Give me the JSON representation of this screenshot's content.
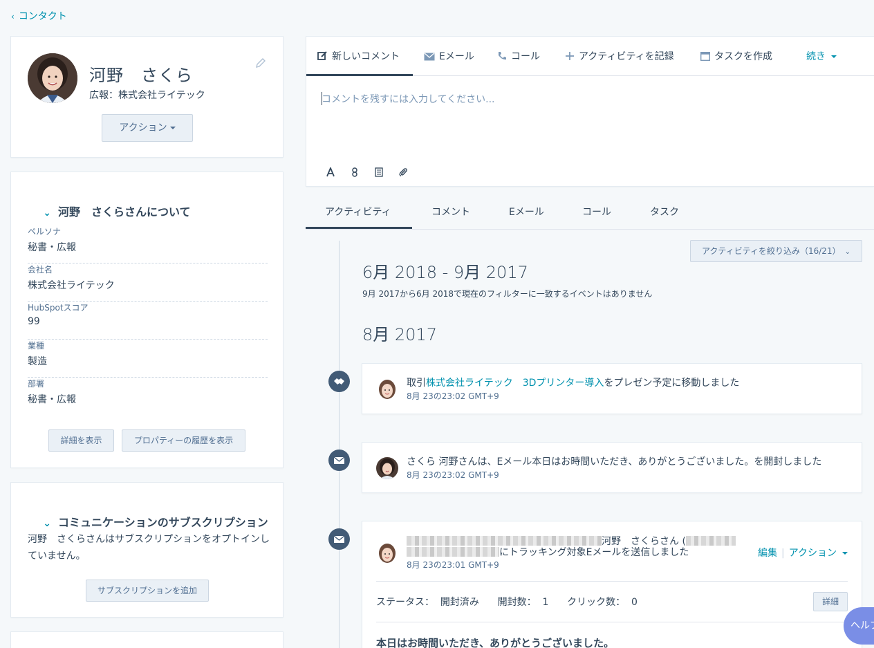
{
  "nav": {
    "back_label": "コンタクト"
  },
  "profile": {
    "name": "河野　さくら",
    "title": "広報：株式会社ライテック",
    "action_button": "アクション"
  },
  "about": {
    "heading": "河野　さくらさんについて",
    "properties": [
      {
        "label": "ペルソナ",
        "value": "秘書・広報"
      },
      {
        "label": "会社名",
        "value": "株式会社ライテック"
      },
      {
        "label": "HubSpotスコア",
        "value": "99"
      },
      {
        "label": "業種",
        "value": "製造"
      },
      {
        "label": "部署",
        "value": "秘書・広報"
      }
    ],
    "show_details_button": "詳細を表示",
    "property_history_button": "プロパティーの履歴を表示"
  },
  "subscriptions": {
    "heading": "コミュニケーションのサブスクリプション",
    "text": "河野　さくらさんはサブスクリプションをオプトインしていません。",
    "add_button": "サブスクリプションを追加"
  },
  "composer": {
    "tabs": [
      {
        "label": "新しいコメント",
        "icon": "edit-icon"
      },
      {
        "label": "Eメール",
        "icon": "email-icon"
      },
      {
        "label": "コール",
        "icon": "phone-icon"
      },
      {
        "label": "アクティビティを記録",
        "icon": "plus-icon"
      },
      {
        "label": "タスクを作成",
        "icon": "task-icon"
      }
    ],
    "more_label": "続き",
    "placeholder": "コメントを残すには入力してください..."
  },
  "activity_tabs": [
    "アクティビティ",
    "コメント",
    "Eメール",
    "コール",
    "タスク"
  ],
  "timeline": {
    "filter_label": "アクティビティを絞り込み（16/21）",
    "period1": "6月 2018 - 9月 2017",
    "period1_note": "9月 2017から6月 2018で現在のフィルターに一致するイベントはありません",
    "period2": "8月 2017",
    "events": [
      {
        "prefix": "取引",
        "link": "株式会社ライテック　3Dプリンター導入",
        "suffix": "をプレゼン予定に移動しました",
        "time": "8月 23の23:02 GMT+9"
      },
      {
        "text": "さくら 河野さんは、Eメール本日はお時間いただき、ありがとうございました。を開封しました",
        "time": "8月 23の23:02 GMT+9"
      },
      {
        "line1_suffix": "河野　さくらさん (",
        "line2_suffix": "にトラッキング対象Eメールを送信しました",
        "time": "8月 23の23:01 GMT+9",
        "edit_label": "編集",
        "action_label": "アクション",
        "stats": "ステータス：  開封済み      開封数：  1      クリック数：  0",
        "detail_button": "詳細",
        "subject": "本日はお時間いただき、ありがとうございました。"
      }
    ]
  },
  "help_label": "ヘルプ",
  "colors": {
    "accent": "#0091ae",
    "dark": "#33475b",
    "icon_bg": "#425b76"
  }
}
